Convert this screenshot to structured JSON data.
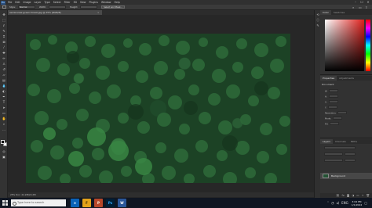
{
  "app": {
    "logo": "Ps",
    "menu": [
      "File",
      "Edit",
      "Image",
      "Layer",
      "Type",
      "Select",
      "Filter",
      "3D",
      "View",
      "Plugins",
      "Window",
      "Help"
    ],
    "window_controls": [
      "–",
      "☐",
      "✕"
    ]
  },
  "options": {
    "style_label": "Style:",
    "style_value": "Normal",
    "width_label": "Width:",
    "height_label": "Height:",
    "select_mask_label": "Select and Mask..."
  },
  "document": {
    "tab_title": "aerial-view-green-forest.jpg @ 25% (RGB/8)",
    "tab_close": "×",
    "status": "25%  Doc: 22.2M/22.2M"
  },
  "panels": {
    "color_tabs": [
      "Color",
      "Swatches"
    ],
    "props_tabs": [
      "Properties",
      "Adjustments"
    ],
    "props_title": "Document",
    "props_rows": [
      "W:",
      "H:",
      "X:",
      "Y:",
      "Resolution:",
      "Mode:",
      "Fill:"
    ],
    "layers_tabs": [
      "Layers",
      "Channels",
      "Paths"
    ],
    "layer_name": "Background"
  },
  "taskbar": {
    "search_placeholder": "Type here to search",
    "apps": [
      "e",
      "F",
      "P",
      "Ps",
      "W"
    ],
    "clock_time": "3:04 PM",
    "clock_date": "1/1/2024",
    "lang": "ENG"
  },
  "colors": {
    "foreground": "#000000",
    "background": "#ffffff",
    "forest": "#1c4225"
  }
}
